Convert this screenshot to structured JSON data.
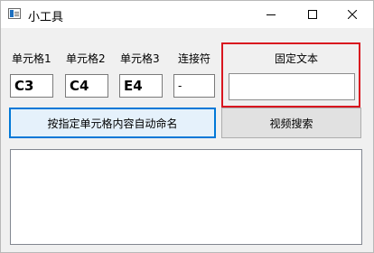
{
  "window": {
    "title": "小工具",
    "icon": "app-window-icon",
    "controls": [
      "minimize-icon",
      "maximize-icon",
      "close-icon"
    ]
  },
  "labels": {
    "cell1": "单元格1",
    "cell2": "单元格2",
    "cell3": "单元格3",
    "connector": "连接符",
    "fixed_text": "固定文本"
  },
  "fields": {
    "cell1_value": "C3",
    "cell2_value": "C4",
    "cell3_value": "E4",
    "connector_value": "-",
    "fixed_text_value": ""
  },
  "buttons": {
    "rename": "按指定单元格内容自动命名",
    "video_search": "视频搜索"
  },
  "output": {
    "value": ""
  },
  "colors": {
    "highlight_border": "#d9161f",
    "focus_border": "#0078d7"
  }
}
